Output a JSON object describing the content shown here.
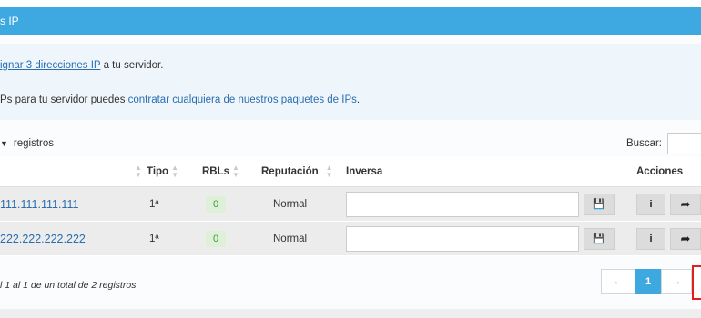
{
  "panel": {
    "title": "s IP"
  },
  "info": {
    "line1_pre": "ignar 3 direcciones IP",
    "line1_post": " a tu servidor.",
    "line2_pre": "Ps para tu servidor puedes ",
    "line2_link": "contratar cualquiera de nuestros paquetes de IPs",
    "line2_post": "."
  },
  "length_control": {
    "label": "registros"
  },
  "search": {
    "label": "Buscar:",
    "value": "",
    "placeholder": ""
  },
  "table": {
    "columns": {
      "tipo": "Tipo",
      "rbls": "RBLs",
      "reputacion": "Reputación",
      "inversa": "Inversa",
      "acciones": "Acciones"
    },
    "rows": [
      {
        "ip": "111.111.111.111",
        "tipo": "1ª",
        "rbls": "0",
        "reputacion": "Normal",
        "inversa": ""
      },
      {
        "ip": "222.222.222.222",
        "tipo": "1ª",
        "rbls": "0",
        "reputacion": "Normal",
        "inversa": ""
      }
    ]
  },
  "footer": {
    "info": "l 1 al 1 de un total de 2 registros"
  },
  "pagination": {
    "prev": "←",
    "current": "1",
    "next": "→"
  },
  "icons": {
    "sort": "sort-icon",
    "save": "save-icon",
    "info": "info-icon",
    "share": "share-icon",
    "dropdown": "chevron-down-icon"
  },
  "colors": {
    "header_blue": "#3da9e0",
    "link_blue": "#2a6db0",
    "badge_green_bg": "#dff0d8",
    "badge_green_fg": "#3c9a3c",
    "highlight_red": "#e02020"
  }
}
